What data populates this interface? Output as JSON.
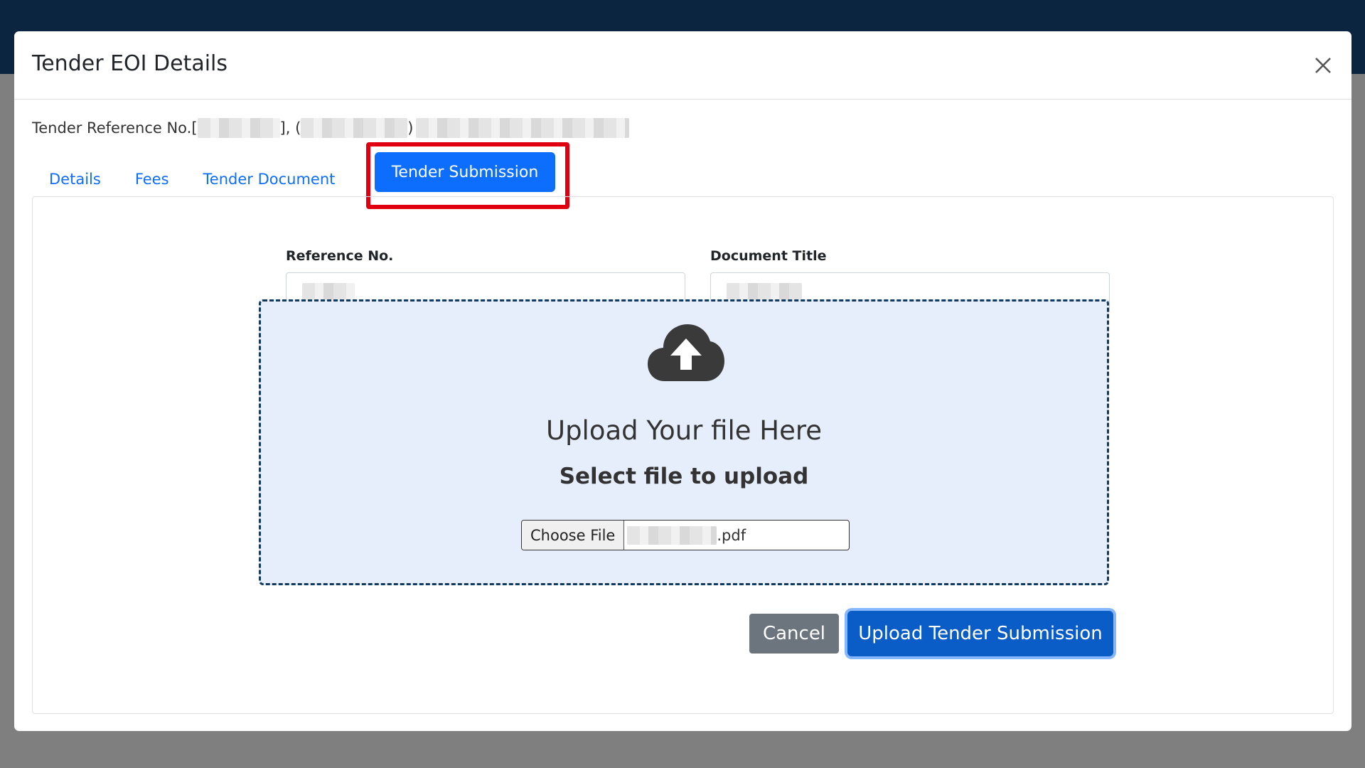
{
  "modal": {
    "title": "Tender EOI Details",
    "ref_prefix": "Tender Reference No.[",
    "ref_sep1": "], (",
    "ref_sep2": ")"
  },
  "tabs": [
    {
      "label": "Details"
    },
    {
      "label": "Fees"
    },
    {
      "label": "Tender Document"
    },
    {
      "label": "Tender Submission"
    }
  ],
  "form": {
    "reference_label": "Reference No.",
    "document_title_label": "Document Title"
  },
  "upload": {
    "heading": "Upload Your file Here",
    "subheading": "Select file to upload",
    "choose_label": "Choose File",
    "file_ext": ".pdf"
  },
  "buttons": {
    "cancel": "Cancel",
    "submit": "Upload Tender Submission"
  },
  "icons": {
    "close": "close-icon",
    "upload": "cloud-upload-icon"
  },
  "colors": {
    "primary": "#0d6efd",
    "highlight": "#e0000f",
    "secondary": "#6c757d",
    "header": "#0b2540"
  }
}
